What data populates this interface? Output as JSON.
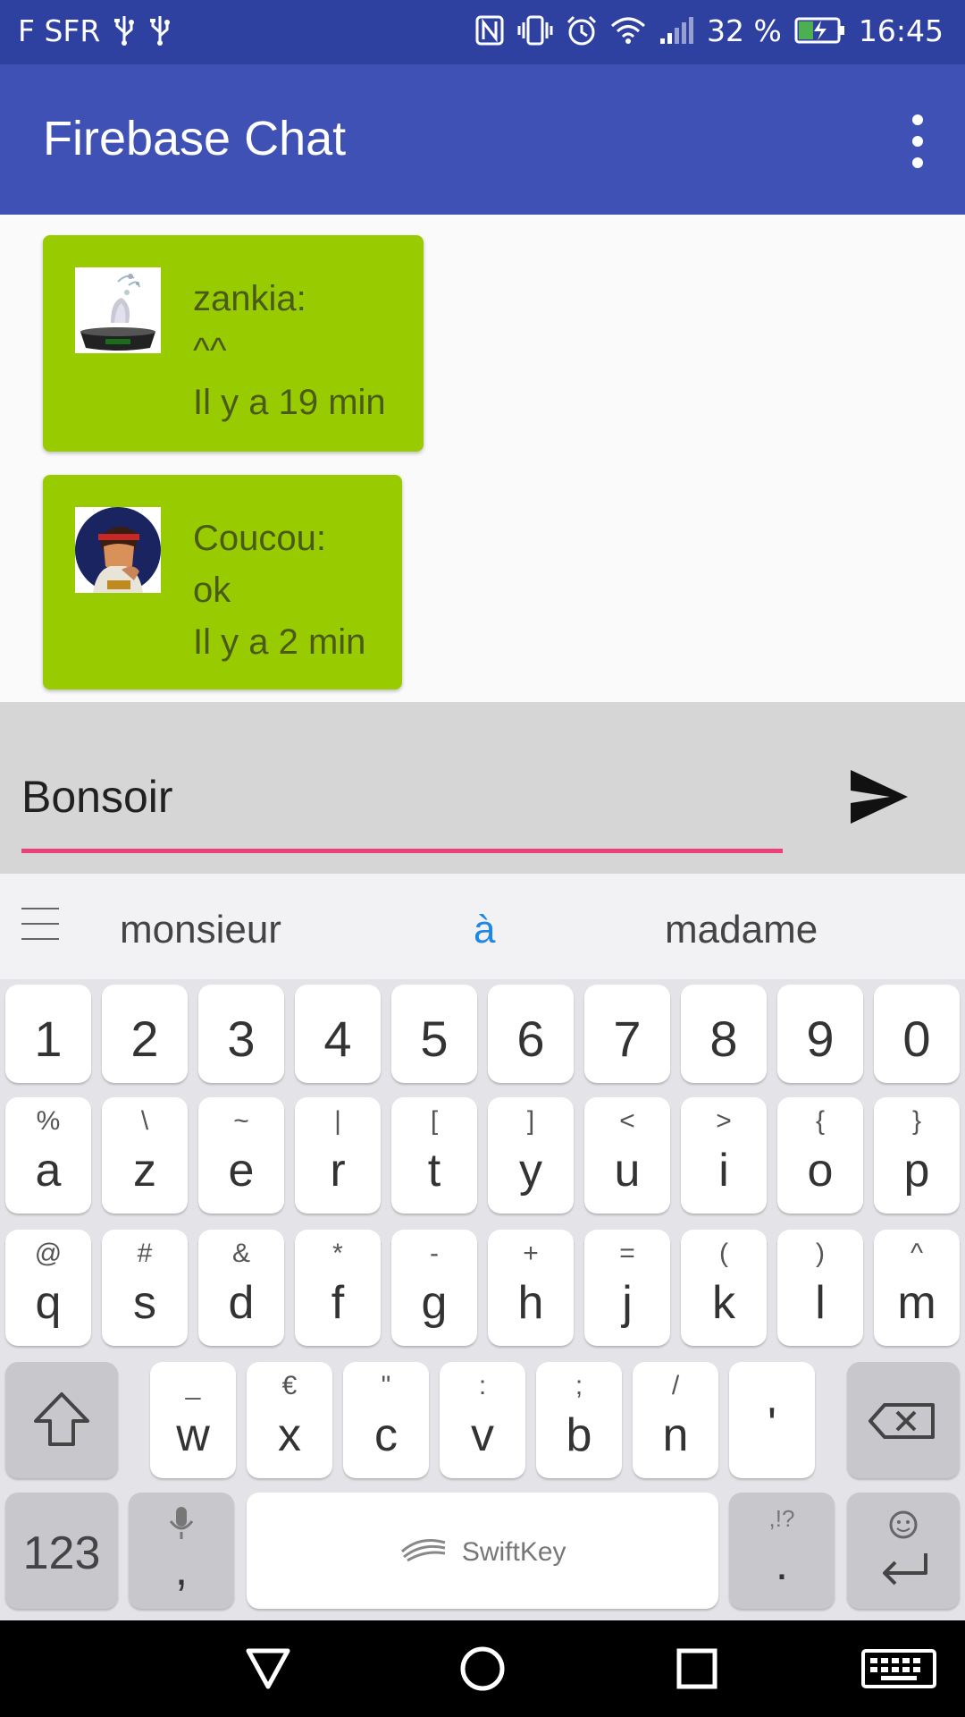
{
  "status_bar": {
    "carrier": "F SFR",
    "battery": "32 %",
    "time": "16:45"
  },
  "app_bar": {
    "title": "Firebase Chat"
  },
  "messages": [
    {
      "author": "zankia:",
      "text": "^^",
      "time": "Il y a 19 min",
      "avatar": "zankia-logo"
    },
    {
      "author": "Coucou:",
      "text": "ok",
      "time": "Il y a 2 min",
      "avatar": "ryu-portrait"
    }
  ],
  "composer": {
    "value": "Bonsoir"
  },
  "suggestions": [
    "monsieur",
    "à",
    "madame"
  ],
  "keyboard": {
    "row_numbers": [
      "1",
      "2",
      "3",
      "4",
      "5",
      "6",
      "7",
      "8",
      "9",
      "0"
    ],
    "row1": [
      {
        "main": "a",
        "hint": "%"
      },
      {
        "main": "z",
        "hint": "\\"
      },
      {
        "main": "e",
        "hint": "~"
      },
      {
        "main": "r",
        "hint": "|"
      },
      {
        "main": "t",
        "hint": "["
      },
      {
        "main": "y",
        "hint": "]"
      },
      {
        "main": "u",
        "hint": "<"
      },
      {
        "main": "i",
        "hint": ">"
      },
      {
        "main": "o",
        "hint": "{"
      },
      {
        "main": "p",
        "hint": "}"
      }
    ],
    "row2": [
      {
        "main": "q",
        "hint": "@"
      },
      {
        "main": "s",
        "hint": "#"
      },
      {
        "main": "d",
        "hint": "&"
      },
      {
        "main": "f",
        "hint": "*"
      },
      {
        "main": "g",
        "hint": "-"
      },
      {
        "main": "h",
        "hint": "+"
      },
      {
        "main": "j",
        "hint": "="
      },
      {
        "main": "k",
        "hint": "("
      },
      {
        "main": "l",
        "hint": ")"
      },
      {
        "main": "m",
        "hint": "^"
      }
    ],
    "row3": [
      {
        "main": "w",
        "hint": "_"
      },
      {
        "main": "x",
        "hint": "€"
      },
      {
        "main": "c",
        "hint": "\""
      },
      {
        "main": "v",
        "hint": ":"
      },
      {
        "main": "b",
        "hint": ";"
      },
      {
        "main": "n",
        "hint": "/"
      },
      {
        "main": "'",
        "hint": ""
      }
    ],
    "num_switch": "123",
    "comma": ",",
    "space_label": "SwiftKey",
    "period": ".",
    "period_hint": ",!?"
  },
  "colors": {
    "status_bar": "#2f41a0",
    "app_bar": "#3f51b5",
    "bubble": "#99cc00",
    "accent": "#ec407a",
    "suggestion_highlight": "#1e88e5"
  }
}
